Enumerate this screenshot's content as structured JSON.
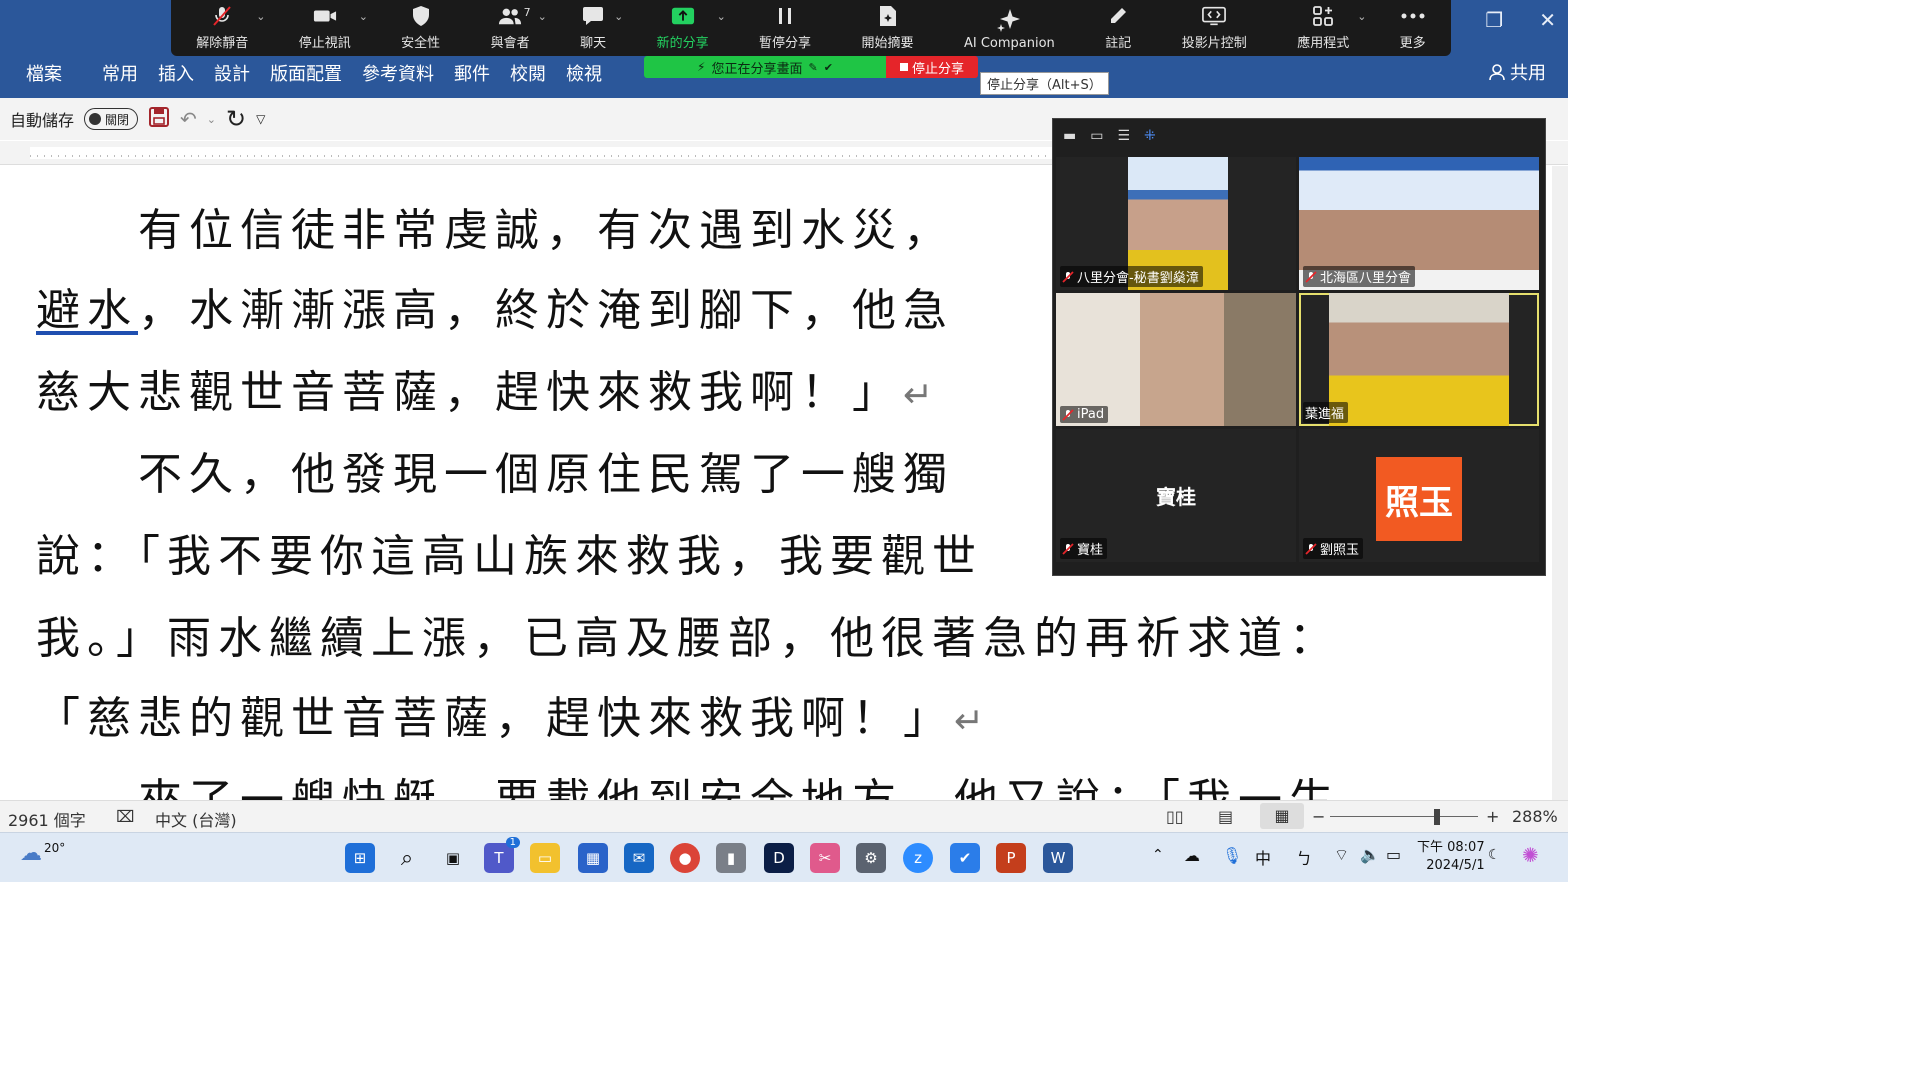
{
  "ribbon": {
    "tabs": [
      "檔案",
      "常用",
      "插入",
      "設計",
      "版面配置",
      "參考資料",
      "郵件",
      "校閱",
      "檢視"
    ],
    "share_label": "共用"
  },
  "zoom": {
    "buttons": [
      {
        "label": "解除靜音",
        "icon": "mic-muted-icon",
        "caret": true
      },
      {
        "label": "停止視訊",
        "icon": "video-camera-icon",
        "caret": true
      },
      {
        "label": "安全性",
        "icon": "shield-icon",
        "caret": false
      },
      {
        "label": "與會者",
        "icon": "participants-icon",
        "caret": true,
        "count": "7"
      },
      {
        "label": "聊天",
        "icon": "chat-bubble-icon",
        "caret": true
      },
      {
        "label": "新的分享",
        "icon": "share-arrow-icon",
        "caret": true,
        "green": true
      },
      {
        "label": "暫停分享",
        "icon": "pause-icon",
        "caret": false
      },
      {
        "label": "開始摘要",
        "icon": "summary-doc-icon",
        "caret": false
      },
      {
        "label": "AI Companion",
        "icon": "sparkle-icon",
        "caret": false
      },
      {
        "label": "註記",
        "icon": "pencil-icon",
        "caret": false
      },
      {
        "label": "投影片控制",
        "icon": "slide-control-icon",
        "caret": false
      },
      {
        "label": "應用程式",
        "icon": "apps-icon",
        "caret": true
      },
      {
        "label": "更多",
        "icon": "more-dots-icon",
        "caret": false
      }
    ],
    "sharing_banner": "您正在分享畫面",
    "stop_share": "停止分享",
    "tooltip": "停止分享（Alt+S）"
  },
  "qat": {
    "autosave_label": "自動儲存",
    "autosave_state": "關閉"
  },
  "document": {
    "lines": [
      "　　有位信徒非常虔誠，有次遇到水災，",
      "避水",
      "，水漸漸漲高，終於淹到腳下，他急",
      "慈大悲觀世音菩薩，趕快來救我啊！」",
      "　　不久，他發現一個原住民駕了一艘獨",
      "說：「我不要你這高山族來救我，我要觀世",
      "我。」雨水繼續上漲，已高及腰部，他很著急的再祈求道：",
      "「慈悲的觀世音菩薩，趕快來救我啊！」",
      "　　來了一艘快艇，要載他到安全地方，他又說：「我一生"
    ],
    "para_mark": "↵"
  },
  "status": {
    "word_count": "2961 個字",
    "language": "中文 (台灣)",
    "zoom": "288%"
  },
  "gallery": {
    "tiles": [
      {
        "name": "八里分會-秘書劉燊漳",
        "muted": true,
        "video": true
      },
      {
        "name": "北海區八里分會",
        "muted": true,
        "video": true
      },
      {
        "name": "iPad",
        "muted": true,
        "video": true
      },
      {
        "name": "葉進福",
        "muted": false,
        "video": true,
        "speaking": true
      },
      {
        "name": "寶桂",
        "muted": true,
        "video": false,
        "display": "寶桂"
      },
      {
        "name": "劉照玉",
        "muted": true,
        "video": false,
        "avatar": "照玉"
      }
    ]
  },
  "taskbar": {
    "weather": "20°",
    "ime": "中",
    "clock_time": "下午 08:07",
    "clock_date": "2024/5/1",
    "teams_badge": "1"
  },
  "colors": {
    "word_blue": "#2b579a",
    "zoom_green": "#1fc545",
    "stop_red": "#e5252a",
    "speaker_border": "#e6df6d",
    "avatar_orange": "#f25a22"
  }
}
